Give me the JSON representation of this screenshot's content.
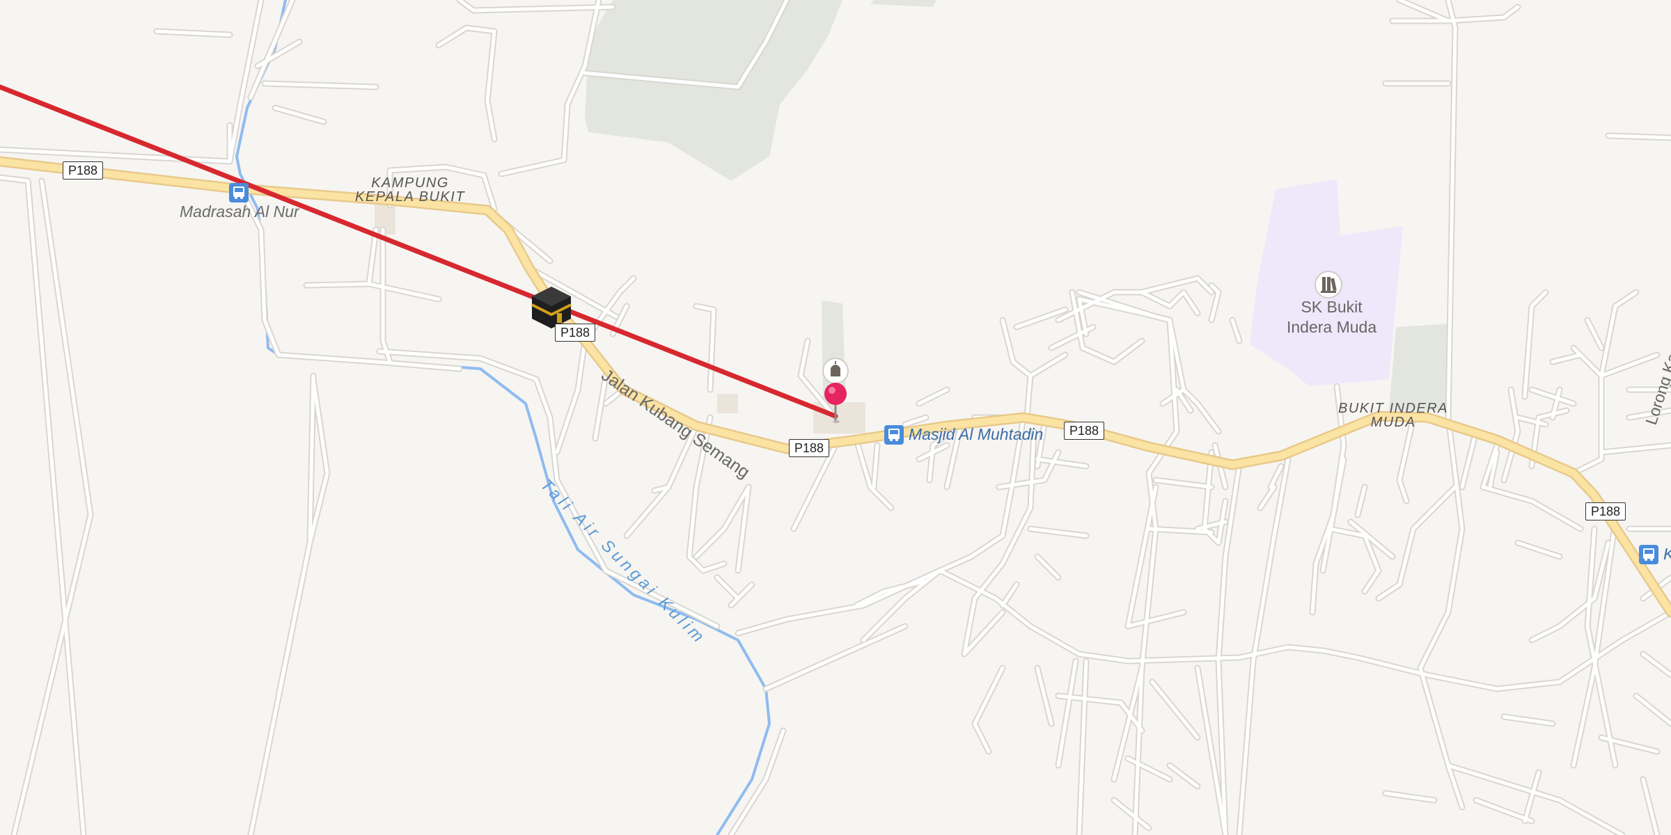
{
  "map": {
    "colors": {
      "background": "#f7f5f2",
      "minor_road": "#ffffff",
      "minor_road_casing": "#d9d6d1",
      "primary_road": "#fbe3a4",
      "primary_road_casing": "#e8c98a",
      "waterway": "#8fbbf0",
      "park": "#e3e6df",
      "school_area": "#efe8fa",
      "route_line": "#d7282f",
      "pin": "#e6245f",
      "bus_stop": "#4a8cdc"
    },
    "places": [
      {
        "name": "KAMPUNG\nKEPALA BUKIT"
      },
      {
        "name": "BUKIT INDERA\nMUDA"
      }
    ],
    "roads": [
      {
        "name": "Jalan Kubang Semang"
      },
      {
        "name": "Lorong Kampung Perai"
      }
    ],
    "waterways": [
      {
        "name": "Tali Air Sungai Kulim"
      }
    ],
    "route_shields": [
      "P188",
      "P188",
      "P188",
      "P188",
      "P188"
    ],
    "pois": [
      {
        "name": "Madrasah Al Nur",
        "icon": "bus-stop-icon"
      },
      {
        "name": "Masjid Al Muhtadin",
        "icon": "bus-stop-icon"
      },
      {
        "name": "SK Bukit\nIndera Muda",
        "icon": "school-icon"
      },
      {
        "name": "K",
        "icon": "bus-stop-icon"
      }
    ],
    "markers": [
      {
        "name": "selected-location",
        "icon": "map-pin-icon"
      },
      {
        "name": "kaaba",
        "icon": "kaaba-icon"
      },
      {
        "name": "mosque",
        "icon": "mosque-icon"
      }
    ]
  }
}
